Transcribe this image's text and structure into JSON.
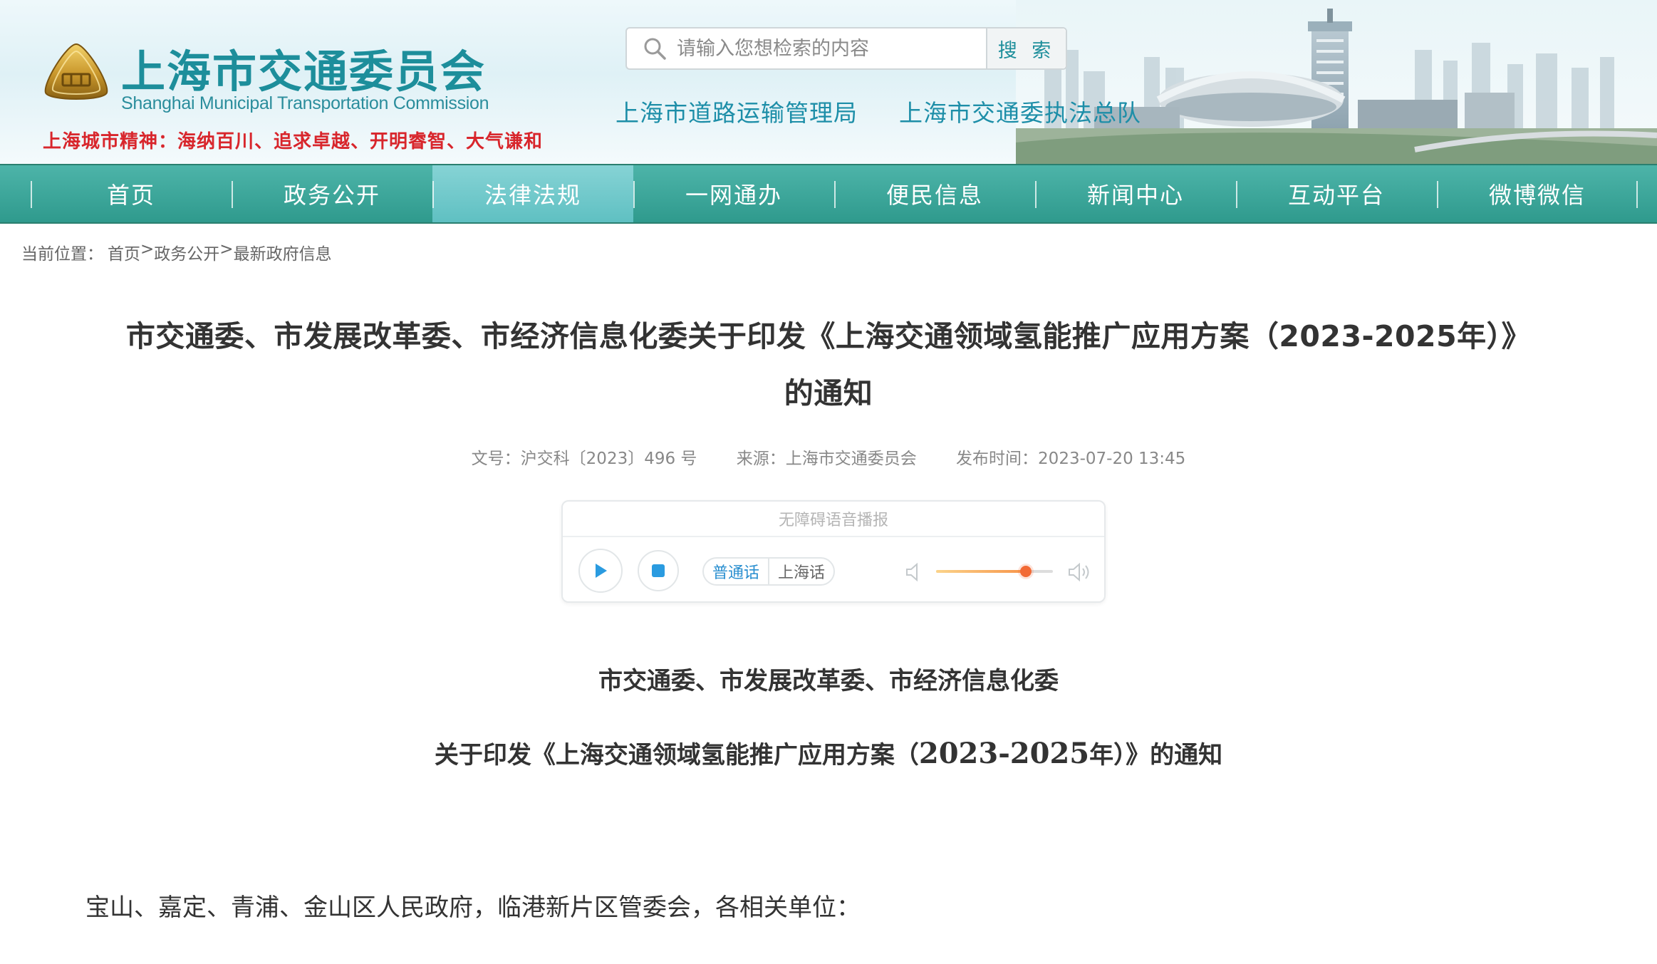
{
  "header": {
    "site_title": "上海市交通委员会",
    "site_subtitle": "Shanghai Municipal Transportation Commission",
    "slogan": "上海城市精神：海纳百川、追求卓越、开明睿智、大气谦和",
    "search": {
      "placeholder": "请输入您想检索的内容",
      "button_label": "搜 索"
    },
    "quick_links": [
      "上海市道路运输管理局",
      "上海市交通委执法总队"
    ]
  },
  "nav": {
    "items": [
      "首页",
      "政务公开",
      "法律法规",
      "一网通办",
      "便民信息",
      "新闻中心",
      "互动平台",
      "微博微信"
    ],
    "active_index": 2
  },
  "breadcrumb": {
    "prefix": "当前位置：",
    "items": [
      "首页",
      "政务公开",
      "最新政府信息"
    ],
    "separator": ">"
  },
  "article": {
    "title_line1": "市交通委、市发展改革委、市经济信息化委关于印发《上海交通领域氢能推广应用方案（2023-2025年）》",
    "title_line2": "的通知",
    "meta": {
      "doc_number": "文号：沪交科〔2023〕496 号",
      "source": "来源：上海市交通委员会",
      "publish_time": "发布时间：2023-07-20 13:45"
    },
    "heading1": "市交通委、市发展改革委、市经济信息化委",
    "heading2_prefix": "关于印发《上海交通领域氢能推广应用方案（",
    "heading2_years": "2023-2025",
    "heading2_suffix": "年）》的通知",
    "salutation": "宝山、嘉定、青浦、金山区人民政府，临港新片区管委会，各相关单位："
  },
  "player": {
    "title": "无障碍语音播报",
    "languages": [
      "普通话",
      "上海话"
    ],
    "active_language_index": 0,
    "volume_fraction": 0.77
  },
  "colors": {
    "brand_teal": "#1d8e9b",
    "nav_green": "#2f9a8d",
    "nav_active": "#6fc7c9",
    "slogan_red": "#d8262c",
    "link_blue": "#2a8fd0",
    "volume_orange": "#f26a35"
  }
}
